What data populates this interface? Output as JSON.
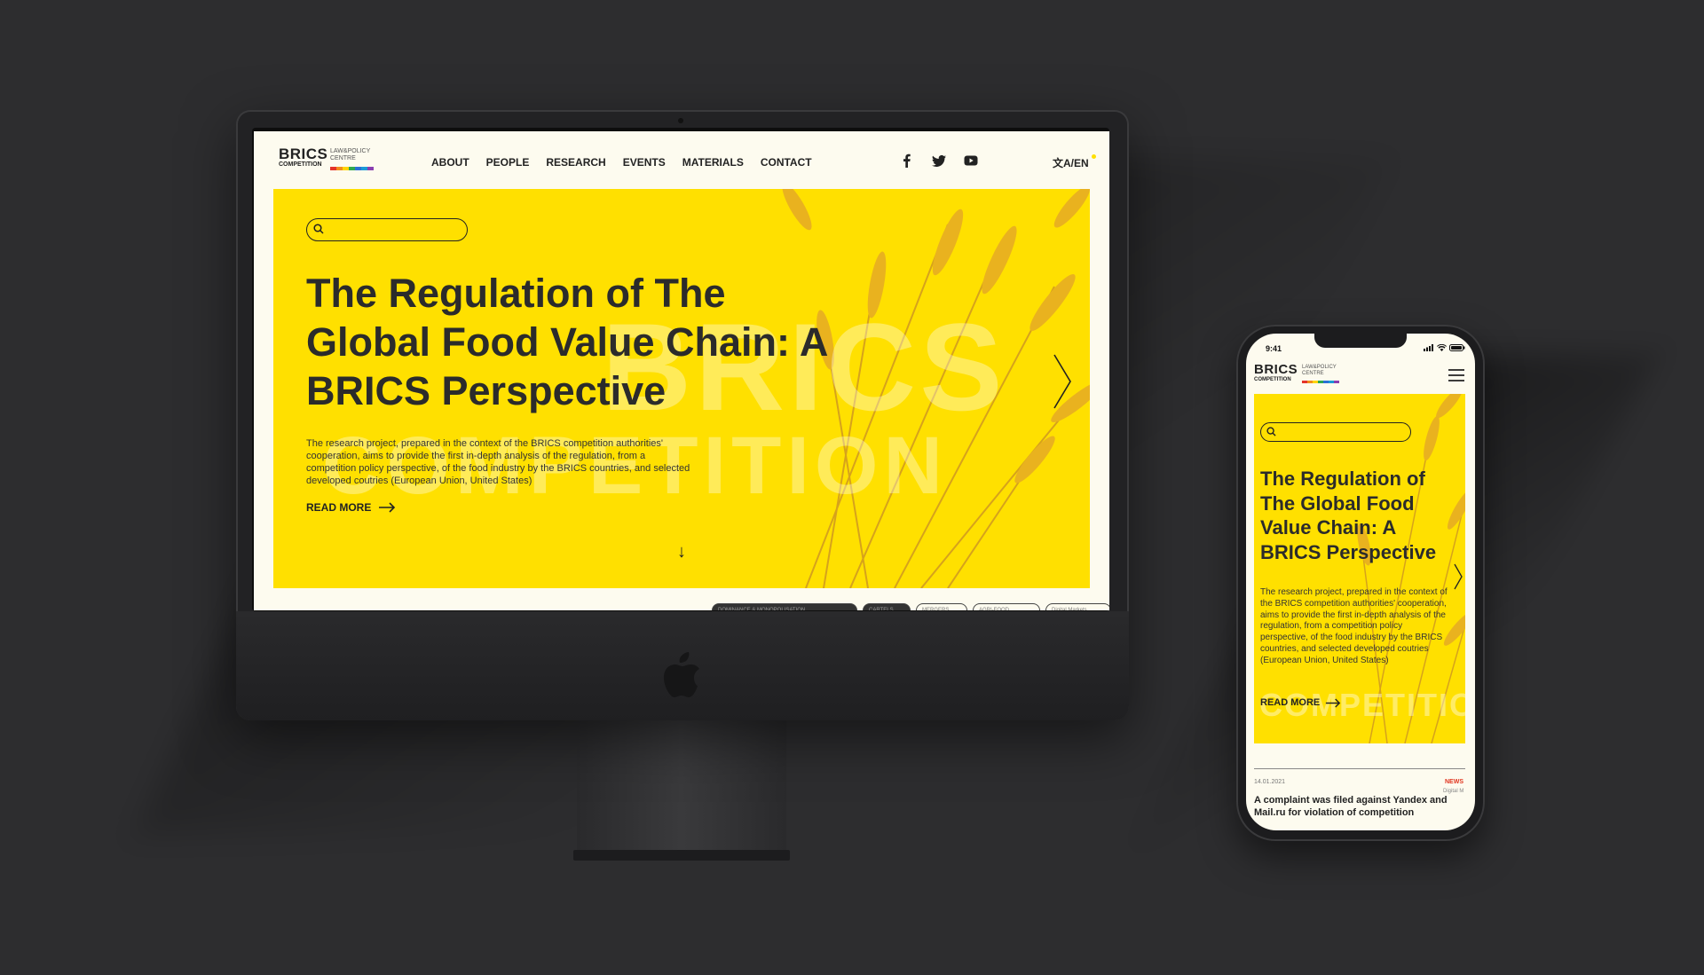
{
  "brand": {
    "name": "BRICS",
    "subtitle": "COMPETITION",
    "side_line1": "LAW&POLICY",
    "side_line2": "CENTRE",
    "bar_colors": [
      "#e4342a",
      "#f28c1c",
      "#ffd400",
      "#2fa84f",
      "#2b6fd6",
      "#1b9ad6",
      "#8a3fb0"
    ]
  },
  "nav": {
    "items": [
      "ABOUT",
      "PEOPLE",
      "RESEARCH",
      "EVENTS",
      "MATERIALS",
      "CONTACT"
    ],
    "social": [
      "facebook-icon",
      "twitter-icon",
      "youtube-icon"
    ],
    "language": "文A/EN"
  },
  "hero": {
    "title": "The Regulation of The Global Food Value Chain: A BRICS Perspective",
    "description": "The research project, prepared in the context of the BRICS competition authorities' cooperation, aims to provide the first in-depth analysis of the regulation, from a competition policy perspective, of the food industry by the BRICS countries, and selected developed coutries (European Union, United States)",
    "read_more": "READ MORE",
    "watermark_line1": "BRICS",
    "watermark_line2": "COMPETITION",
    "search_placeholder": ""
  },
  "chips": [
    "DOMINANCE & MONOPOLISATION",
    "CARTELS",
    "MERGERS",
    "AGRI-FOOD",
    "Digital Markets"
  ],
  "phone": {
    "time": "9:41",
    "news": {
      "date": "14.01.2021",
      "tag": "NEWS",
      "category": "Digital M",
      "headline": "A complaint was filed against Yandex and Mail.ru for violation of competition"
    }
  },
  "colors": {
    "accent_yellow": "#ffe000",
    "page_background": "#fdfbef",
    "news_tag": "#e0341e"
  }
}
